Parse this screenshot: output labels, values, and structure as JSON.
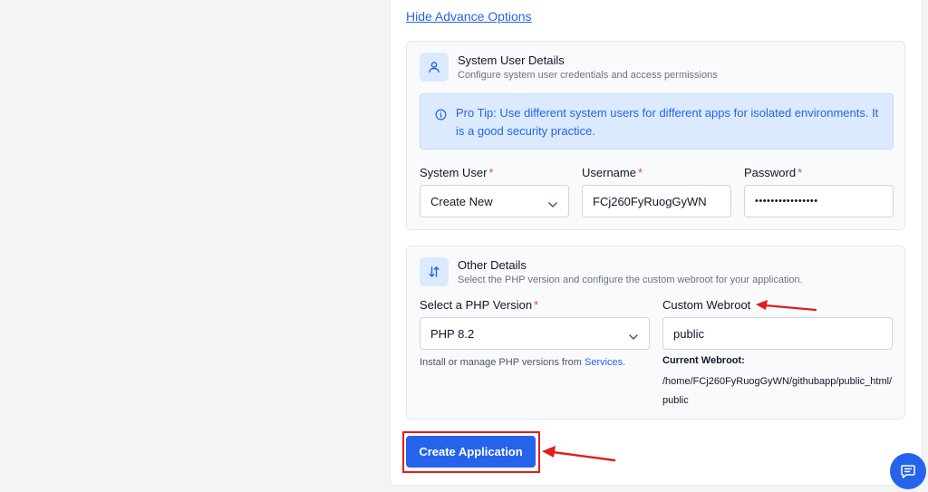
{
  "toggle_link": "Hide Advance Options",
  "system_user_section": {
    "title": "System User Details",
    "description": "Configure system user credentials and access permissions",
    "icon": "user-icon",
    "tip": "Pro Tip: Use different system users for different apps for isolated environments. It is a good security practice.",
    "fields": {
      "system_user": {
        "label": "System User",
        "required": "*",
        "value": "Create New"
      },
      "username": {
        "label": "Username",
        "required": "*",
        "value": "FCj260FyRuogGyWN"
      },
      "password": {
        "label": "Password",
        "required": "*",
        "value": "••••••••••••••••"
      }
    }
  },
  "other_section": {
    "title": "Other Details",
    "description": "Select the PHP version and configure the custom webroot for your application.",
    "icon": "sort-arrows-icon",
    "php_version": {
      "label": "Select a PHP Version",
      "required": "*",
      "value": "PHP 8.2",
      "help_prefix": "Install or manage PHP versions from ",
      "help_link": "Services",
      "help_suffix": "."
    },
    "webroot": {
      "label": "Custom Webroot",
      "value": "public",
      "current_label": "Current Webroot:",
      "current_path": "/home/FCj260FyRuogGyWN/githubapp/public_html/public"
    }
  },
  "create_button": "Create Application",
  "colors": {
    "accent": "#2563eb",
    "annotation": "#e11d1d",
    "required": "#ef4444"
  },
  "chat_fab_icon": "chat-icon"
}
